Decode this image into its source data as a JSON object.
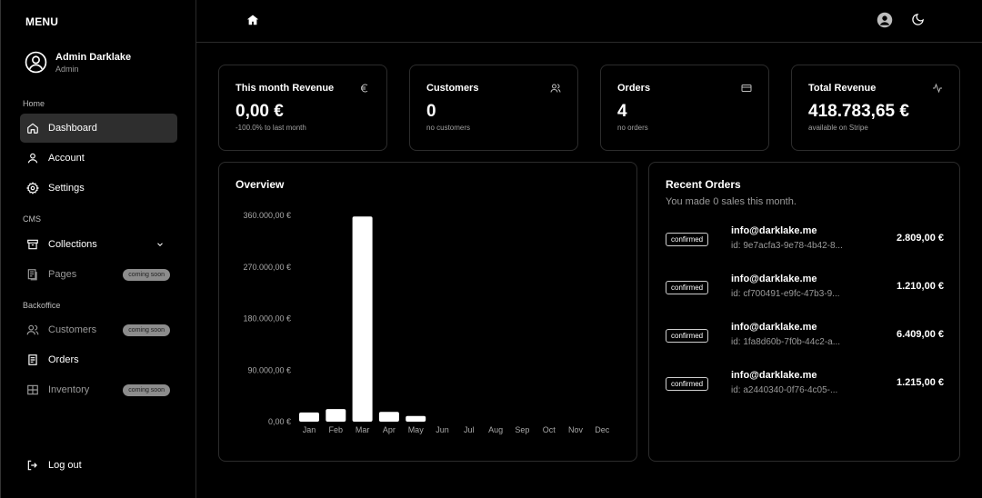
{
  "sidebar": {
    "menu_title": "MENU",
    "user": {
      "name": "Admin Darklake",
      "role": "Admin"
    },
    "sections": {
      "home": "Home",
      "cms": "CMS",
      "backoffice": "Backoffice"
    },
    "items": [
      {
        "label": "Dashboard",
        "icon": "home-icon"
      },
      {
        "label": "Account",
        "icon": "user-icon"
      },
      {
        "label": "Settings",
        "icon": "gear-icon"
      },
      {
        "label": "Collections",
        "icon": "archive-icon"
      },
      {
        "label": "Pages",
        "icon": "pages-icon",
        "badge": "coming soon"
      },
      {
        "label": "Customers",
        "icon": "users-icon",
        "badge": "coming soon"
      },
      {
        "label": "Orders",
        "icon": "document-icon"
      },
      {
        "label": "Inventory",
        "icon": "inventory-icon",
        "badge": "coming soon"
      }
    ],
    "logout": "Log out"
  },
  "stats": [
    {
      "title": "This month Revenue",
      "value": "0,00 €",
      "sub": "-100.0% to last month",
      "icon": "euro-icon"
    },
    {
      "title": "Customers",
      "value": "0",
      "sub": "no customers",
      "icon": "users-icon"
    },
    {
      "title": "Orders",
      "value": "4",
      "sub": "no orders",
      "icon": "credit-card-icon"
    },
    {
      "title": "Total Revenue",
      "value": "418.783,65 €",
      "sub": "available on Stripe",
      "icon": "activity-icon"
    }
  ],
  "overview": {
    "title": "Overview"
  },
  "chart_data": {
    "type": "bar",
    "categories": [
      "Jan",
      "Feb",
      "Mar",
      "Apr",
      "May",
      "Jun",
      "Jul",
      "Aug",
      "Sep",
      "Oct",
      "Nov",
      "Dec"
    ],
    "values": [
      16000,
      22000,
      358000,
      17000,
      10000,
      0,
      0,
      0,
      0,
      0,
      0,
      0
    ],
    "y_ticks": [
      "0,00 €",
      "90.000,00 €",
      "180.000,00 €",
      "270.000,00 €",
      "360.000,00 €"
    ],
    "y_tick_values": [
      0,
      90000,
      180000,
      270000,
      360000
    ],
    "ylim": [
      0,
      360000
    ],
    "bar_color": "#ffffff",
    "grid": false
  },
  "recent_orders": {
    "title": "Recent Orders",
    "subtitle": "You made 0 sales this month.",
    "orders": [
      {
        "status": "confirmed",
        "email": "info@darklake.me",
        "id": "id: 9e7acfa3-9e78-4b42-8...",
        "amount": "2.809,00 €"
      },
      {
        "status": "confirmed",
        "email": "info@darklake.me",
        "id": "id: cf700491-e9fc-47b3-9...",
        "amount": "1.210,00 €"
      },
      {
        "status": "confirmed",
        "email": "info@darklake.me",
        "id": "id: 1fa8d60b-7f0b-44c2-a...",
        "amount": "6.409,00 €"
      },
      {
        "status": "confirmed",
        "email": "info@darklake.me",
        "id": "id: a2440340-0f76-4c05-...",
        "amount": "1.215,00 €"
      }
    ]
  }
}
